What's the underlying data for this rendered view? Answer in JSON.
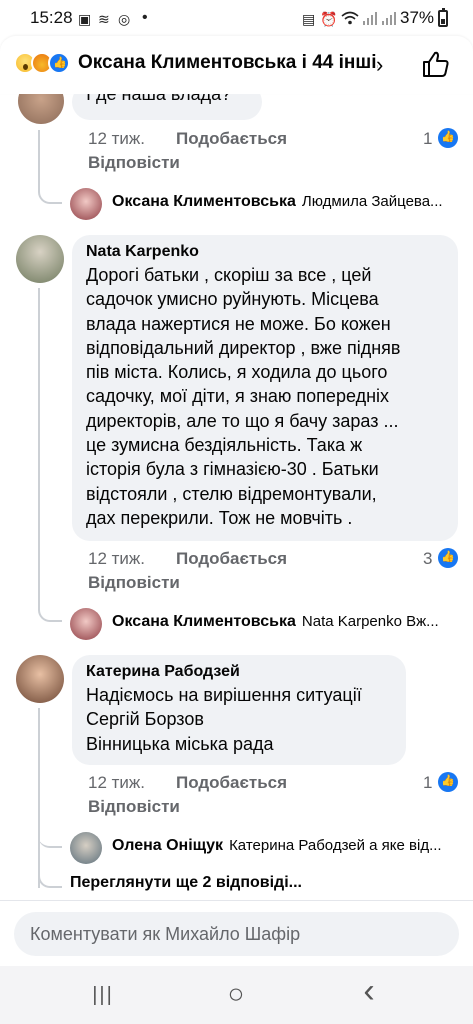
{
  "status_bar": {
    "time": "15:28",
    "battery": "37%"
  },
  "header": {
    "reactors": "Оксана Климентовська і 44 інші...",
    "chevron": "›"
  },
  "comments": [
    {
      "text": "І де наша влада?",
      "time": "12 тиж.",
      "like_label": "Подобається",
      "reply_label": "Відповісти",
      "likes": "1",
      "reply_preview": {
        "author": "Оксана Климентовська",
        "text": "Людмила Зайцева..."
      }
    },
    {
      "author": "Nata Karpenko",
      "text": "Дорогі батьки , скоріш за все , цей\nсадочок умисно руйнують. Місцева\nвлада нажертися не може. Бо кожен\nвідповідальний директор , вже підняв\nпів міста. Колись, я ходила до цього\nсадочку, мої діти, я знаю попередніх\nдиректорів, але то що я бачу зараз ...\nце зумисна бездіяльність. Така ж\nісторія була з гімназією-30 . Батьки\nвідстояли , стелю відремонтували,\nдах перекрили. Тож не мовчіть .",
      "time": "12 тиж.",
      "like_label": "Подобається",
      "reply_label": "Відповісти",
      "likes": "3",
      "reply_preview": {
        "author": "Оксана Климентовська",
        "text": "Nata Karpenko Вж..."
      }
    },
    {
      "author": "Катерина Рабодзей",
      "text": "Надіємось на вирішення ситуації\nСергій Борзов\nВінницька міська рада",
      "time": "12 тиж.",
      "like_label": "Подобається",
      "reply_label": "Відповісти",
      "likes": "1",
      "reply_preview": {
        "author": "Олена Оніщук",
        "text": "Катерина Рабодзей а яке від..."
      },
      "more_replies": "Переглянути ще 2 відповіді..."
    }
  ],
  "composer": {
    "placeholder": "Коментувати як Михайло Шафір"
  },
  "nav": {
    "recents": "|||",
    "home": "○",
    "back": "‹"
  },
  "colors": {
    "accent": "#1877f2",
    "bubble": "#f0f2f5",
    "secondary_text": "#65676b"
  }
}
